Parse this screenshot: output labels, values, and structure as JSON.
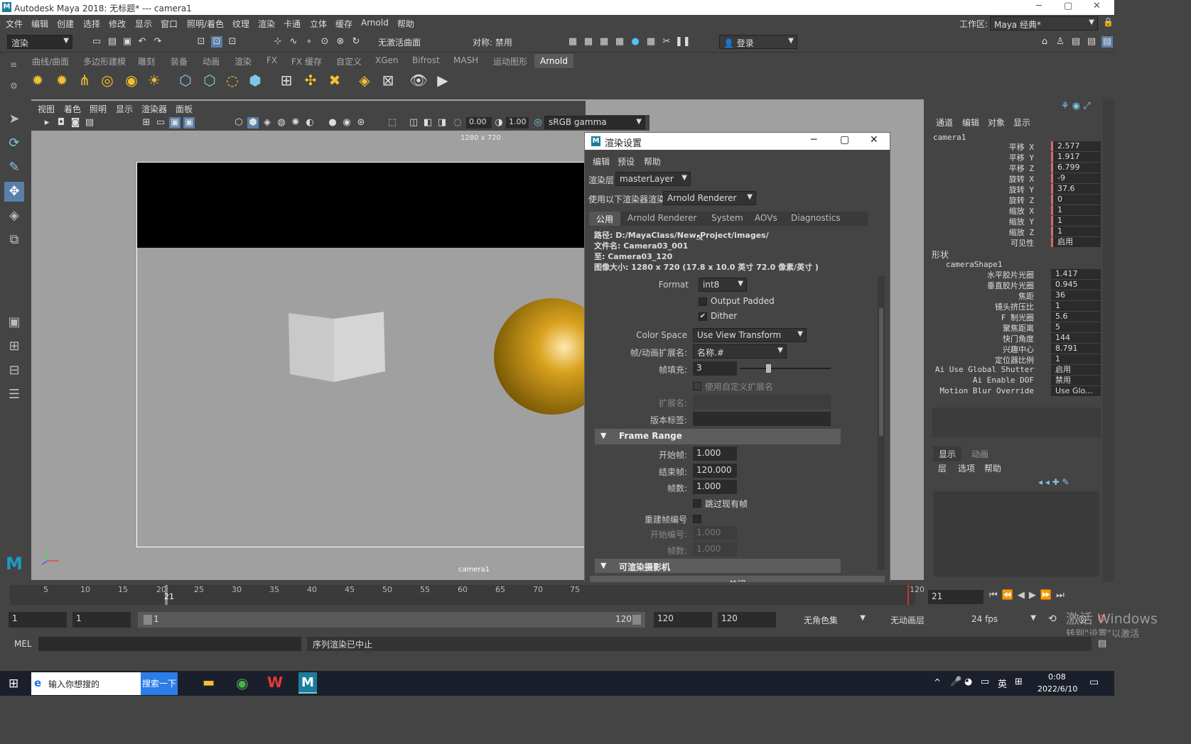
{
  "window": {
    "title": "Autodesk Maya 2018: 无标题*   ---   camera1",
    "min": "─",
    "max": "▢",
    "close": "✕"
  },
  "menubar": {
    "items": [
      "文件",
      "编辑",
      "创建",
      "选择",
      "修改",
      "显示",
      "窗口",
      "照明/着色",
      "纹理",
      "渲染",
      "卡通",
      "立体",
      "缓存",
      "Arnold",
      "帮助"
    ],
    "workspace_label": "工作区:",
    "workspace_value": "Maya 经典*"
  },
  "statusline": {
    "menuset": "渲染",
    "live_surface": "无激活曲面",
    "symmetry": "对称: 禁用",
    "login": "登录"
  },
  "shelf": {
    "tabs": [
      "曲线/曲面",
      "多边形建模",
      "雕刻",
      "装备",
      "动画",
      "渲染",
      "FX",
      "FX 缓存",
      "自定义",
      "XGen",
      "Bifrost",
      "MASH",
      "运动图形",
      "Arnold"
    ],
    "active_tab": "Arnold"
  },
  "viewport": {
    "menu": [
      "视图",
      "着色",
      "照明",
      "显示",
      "渲染器",
      "面板"
    ],
    "exposure": "0.00",
    "gamma": "1.00",
    "color_space": "sRGB gamma",
    "resolution_label": "1280 x 720",
    "camera_label": "camera1"
  },
  "dialog": {
    "title": "渲染设置",
    "menu": [
      "编辑",
      "预设",
      "帮助"
    ],
    "render_layer_label": "渲染层",
    "render_layer": "masterLayer",
    "renderer_label": "使用以下渲染器渲染",
    "renderer": "Arnold Renderer",
    "tabs": [
      "公用",
      "Arnold Renderer",
      "System",
      "AOVs",
      "Diagnostics"
    ],
    "active_tab": "公用",
    "info": {
      "path": "路径: D:/MayaClass/New_Project/images/",
      "filename": "文件名: Camera03_001",
      "to": "至: Camera03_120",
      "imagesize": "图像大小: 1280 x 720 (17.8 x 10.0 英寸 72.0 像素/英寸 )"
    },
    "format_label": "Format",
    "format_value": "int8",
    "output_padded": "Output Padded",
    "dither": "Dither",
    "color_space_label": "Color Space",
    "color_space_value": "Use View Transform",
    "frame_ext_label": "帧/动画扩展名:",
    "frame_ext_value": "名称.#",
    "padding_label": "帧填充:",
    "padding_value": "3",
    "custom_ext_label": "使用自定义扩展名",
    "ext_label": "扩展名:",
    "version_label": "版本标签:",
    "frame_range_header": "Frame Range",
    "start_label": "开始帧:",
    "start_value": "1.000",
    "end_label": "结束帧:",
    "end_value": "120.000",
    "by_label": "帧数:",
    "by_value": "1.000",
    "skip_label": "跳过现有帧",
    "renumber_label": "重建帧编号",
    "renum_start_label": "开始编号:",
    "renum_start_value": "1.000",
    "renum_by_label": "帧数:",
    "renum_by_value": "1.000",
    "cameras_header": "可渲染摄影机",
    "close_button": "关闭"
  },
  "channelbox": {
    "menu": [
      "通道",
      "编辑",
      "对象",
      "显示"
    ],
    "object": "camera1",
    "transform": [
      {
        "label": "平移 X",
        "value": "2.577"
      },
      {
        "label": "平移 Y",
        "value": "1.917"
      },
      {
        "label": "平移 Z",
        "value": "6.799"
      },
      {
        "label": "旋转 X",
        "value": "-9"
      },
      {
        "label": "旋转 Y",
        "value": "37.6"
      },
      {
        "label": "旋转 Z",
        "value": "0"
      },
      {
        "label": "缩放 X",
        "value": "1"
      },
      {
        "label": "缩放 Y",
        "value": "1"
      },
      {
        "label": "缩放 Z",
        "value": "1"
      },
      {
        "label": "可见性",
        "value": "启用"
      }
    ],
    "shapes_label": "形状",
    "shape_name": "cameraShape1",
    "shape_attrs": [
      {
        "label": "水平胶片光圈",
        "value": "1.417"
      },
      {
        "label": "垂直胶片光圈",
        "value": "0.945"
      },
      {
        "label": "焦距",
        "value": "36"
      },
      {
        "label": "镜头挤压比",
        "value": "1"
      },
      {
        "label": "F 制光圈",
        "value": "5.6"
      },
      {
        "label": "聚焦距离",
        "value": "5"
      },
      {
        "label": "快门角度",
        "value": "144"
      },
      {
        "label": "兴趣中心",
        "value": "8.791"
      },
      {
        "label": "定位器比例",
        "value": "1"
      },
      {
        "label": "Ai Use Global Shutter",
        "value": "启用"
      },
      {
        "label": "Ai Enable DOF",
        "value": "禁用"
      },
      {
        "label": "Motion Blur Override",
        "value": "Use Glo..."
      }
    ],
    "layer_tabs": [
      "显示",
      "动画"
    ],
    "layer_menu": [
      "层",
      "选项",
      "帮助"
    ]
  },
  "timeline": {
    "ticks": [
      "5",
      "10",
      "15",
      "20",
      "25",
      "30",
      "35",
      "40",
      "45",
      "50",
      "55",
      "60",
      "65",
      "70",
      "75",
      "120"
    ],
    "current": "21",
    "current_field": "21"
  },
  "range": {
    "start": "1",
    "anim_start": "1",
    "slider_start": "1",
    "slider_end": "120",
    "anim_end": "120",
    "end": "120",
    "char_set": "无角色集",
    "anim_layer": "无动画层",
    "fps": "24 fps"
  },
  "cmdline": {
    "mode": "MEL",
    "feedback": "序列渲染已中止"
  },
  "watermark": {
    "line1": "激活 Windows",
    "line2": "转到\"设置\"以激活 Windows。"
  },
  "taskbar": {
    "search_placeholder": "输入你想搜的",
    "search_button": "搜索一下",
    "ime": "英",
    "time": "0:08",
    "date": "2022/6/10"
  }
}
